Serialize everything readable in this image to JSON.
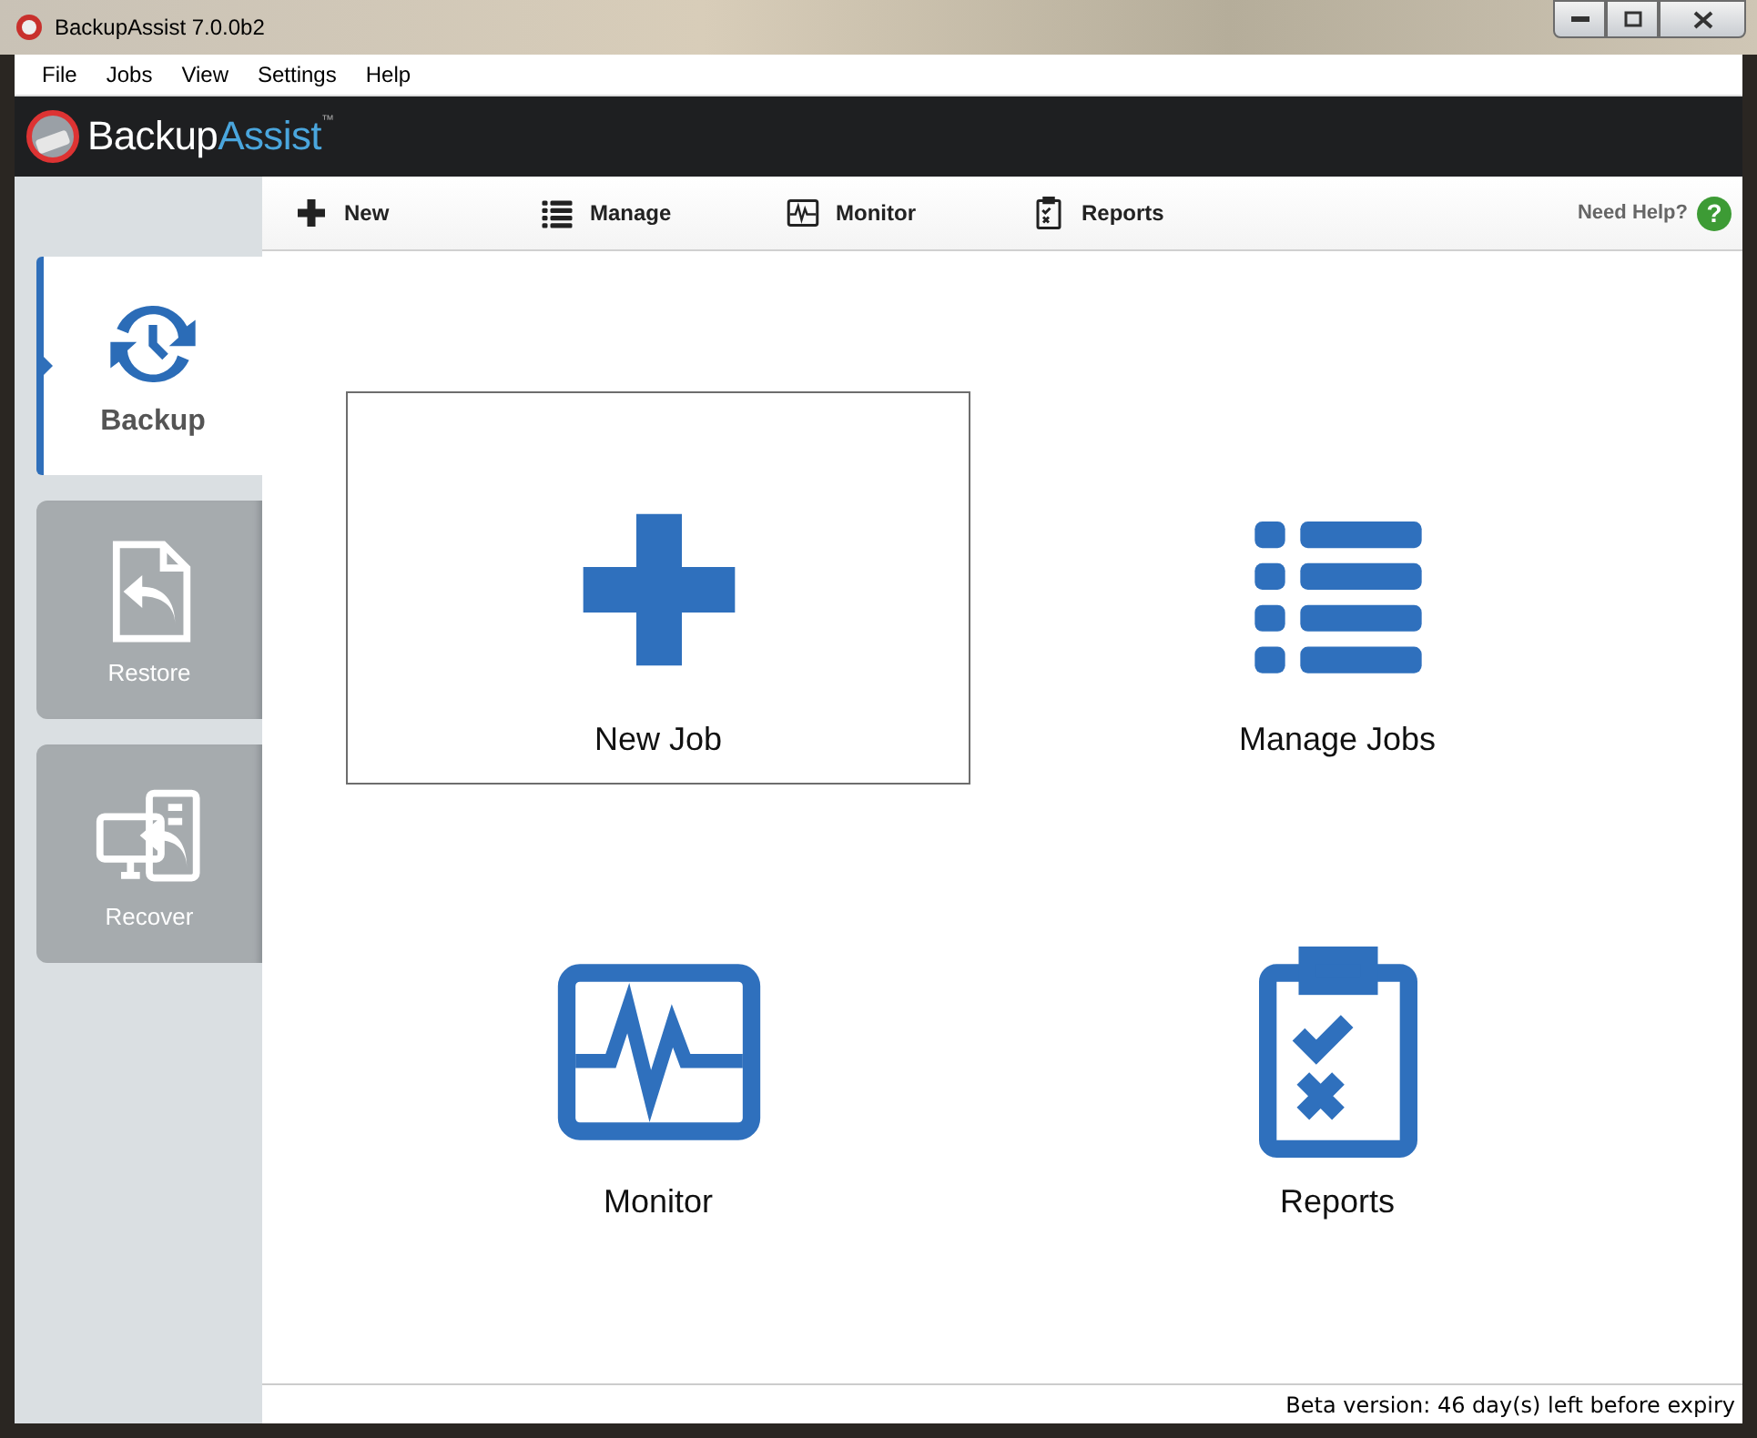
{
  "window": {
    "title": "BackupAssist 7.0.0b2"
  },
  "menu": [
    "File",
    "Jobs",
    "View",
    "Settings",
    "Help"
  ],
  "brand": {
    "first": "Backup",
    "second": "Assist",
    "mark": "™"
  },
  "toolbar": [
    {
      "kind": "new",
      "label": "New"
    },
    {
      "kind": "manage",
      "label": "Manage"
    },
    {
      "kind": "monitor",
      "label": "Monitor"
    },
    {
      "kind": "reports",
      "label": "Reports"
    }
  ],
  "help": {
    "label": "Need Help?",
    "icon": "?"
  },
  "sidebar": [
    {
      "kind": "backup",
      "label": "Backup",
      "selected": true
    },
    {
      "kind": "restore",
      "label": "Restore",
      "selected": false
    },
    {
      "kind": "recover",
      "label": "Recover",
      "selected": false
    }
  ],
  "tiles": [
    {
      "kind": "new",
      "label": "New Job",
      "selected": true
    },
    {
      "kind": "manage",
      "label": "Manage Jobs",
      "selected": false
    },
    {
      "kind": "monitor",
      "label": "Monitor",
      "selected": false
    },
    {
      "kind": "reports",
      "label": "Reports",
      "selected": false
    }
  ],
  "status_bar": "Beta version: 46 day(s) left before expiry"
}
